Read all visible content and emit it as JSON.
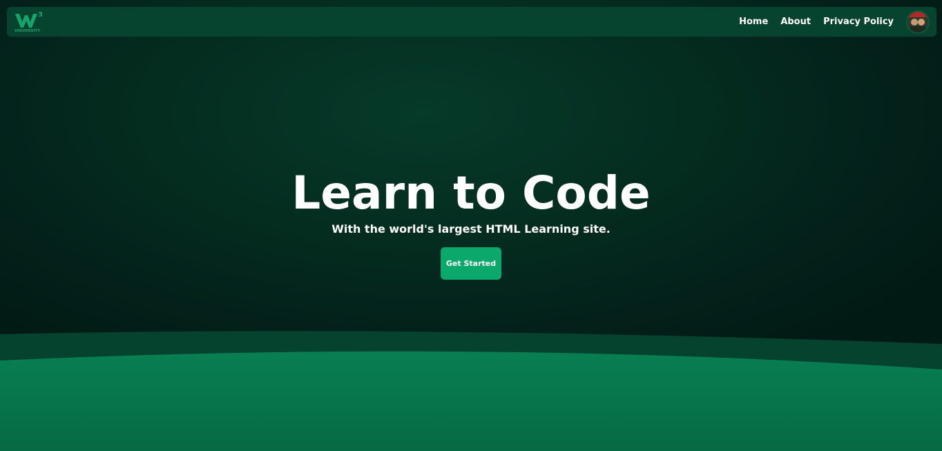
{
  "brand": {
    "logo_superscript": "3",
    "logo_text": "UNIVERSITY",
    "logo_color": "#13a66b"
  },
  "nav": {
    "links": [
      {
        "label": "Home"
      },
      {
        "label": "About"
      },
      {
        "label": "Privacy Policy"
      }
    ],
    "avatar_icon": "user-avatar"
  },
  "hero": {
    "title": "Learn to Code",
    "subtitle": "With the world's largest HTML Learning site.",
    "cta_label": "Get Started"
  },
  "colors": {
    "background": "#03241a",
    "navbar": "#064430",
    "accent": "#0aa86a",
    "wave_dark": "#05452f",
    "wave_light": "#077a4e",
    "text": "#ffffff"
  }
}
